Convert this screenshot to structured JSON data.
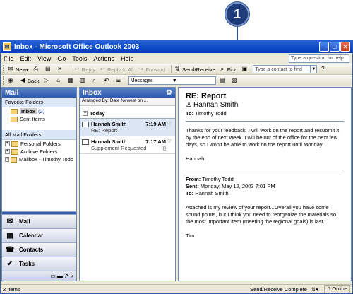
{
  "callout": {
    "number": "1"
  },
  "window": {
    "title": "Inbox - Microsoft Office Outlook 2003"
  },
  "menu": {
    "items": [
      "File",
      "Edit",
      "View",
      "Go",
      "Tools",
      "Actions",
      "Help"
    ],
    "help_placeholder": "Type a question for help"
  },
  "toolbar1": {
    "new": "New",
    "reply": "Reply",
    "reply_all": "Reply to All",
    "forward": "Forward",
    "send_receive": "Send/Receive",
    "find": "Find",
    "contact_placeholder": "Type a contact to find"
  },
  "toolbar2": {
    "back": "Back",
    "view_select": "Messages"
  },
  "nav": {
    "header": "Mail",
    "favorites_label": "Favorite Folders",
    "favorites": [
      {
        "label": "Inbox",
        "count": "(2)"
      },
      {
        "label": "Sent Items"
      }
    ],
    "all_label": "All Mail Folders",
    "folders": [
      "Personal Folders",
      "Archive Folders",
      "Mailbox - Timothy Todd"
    ],
    "buttons": [
      "Mail",
      "Calendar",
      "Contacts",
      "Tasks"
    ]
  },
  "list": {
    "header": "Inbox",
    "arranged_by": "Arranged By: Date   Newest on ...",
    "group": "Today",
    "messages": [
      {
        "from": "Hannah Smith",
        "time": "7:19 AM",
        "subject": "RE: Report"
      },
      {
        "from": "Hannah Smith",
        "time": "7:17 AM",
        "subject": "Supplement Requested"
      }
    ]
  },
  "reading": {
    "subject": "RE: Report",
    "from": "Hannah Smith",
    "to_label": "To:",
    "to": "Timothy Todd",
    "body1": "Thanks for your feedback. I will work on the report and resubmit it by the end of next week. I will be out of the office for the next few days, so I won't be able to work on the report until Monday.",
    "sign1": "Hannah",
    "orig_from_label": "From:",
    "orig_from": "Timothy Todd",
    "orig_sent_label": "Sent:",
    "orig_sent": "Monday, May 12, 2003 7:01 PM",
    "orig_to_label": "To:",
    "orig_to": "Hannah Smith",
    "body2": "Attached is my review of your report...Overall you have some sound points, but I think you need to reorganize the materials so the most important item (meeting the regional goals) is last.",
    "sign2": "Tim"
  },
  "status": {
    "items": "2 Items",
    "send_receive": "Send/Receive Complete",
    "online": "Online"
  }
}
